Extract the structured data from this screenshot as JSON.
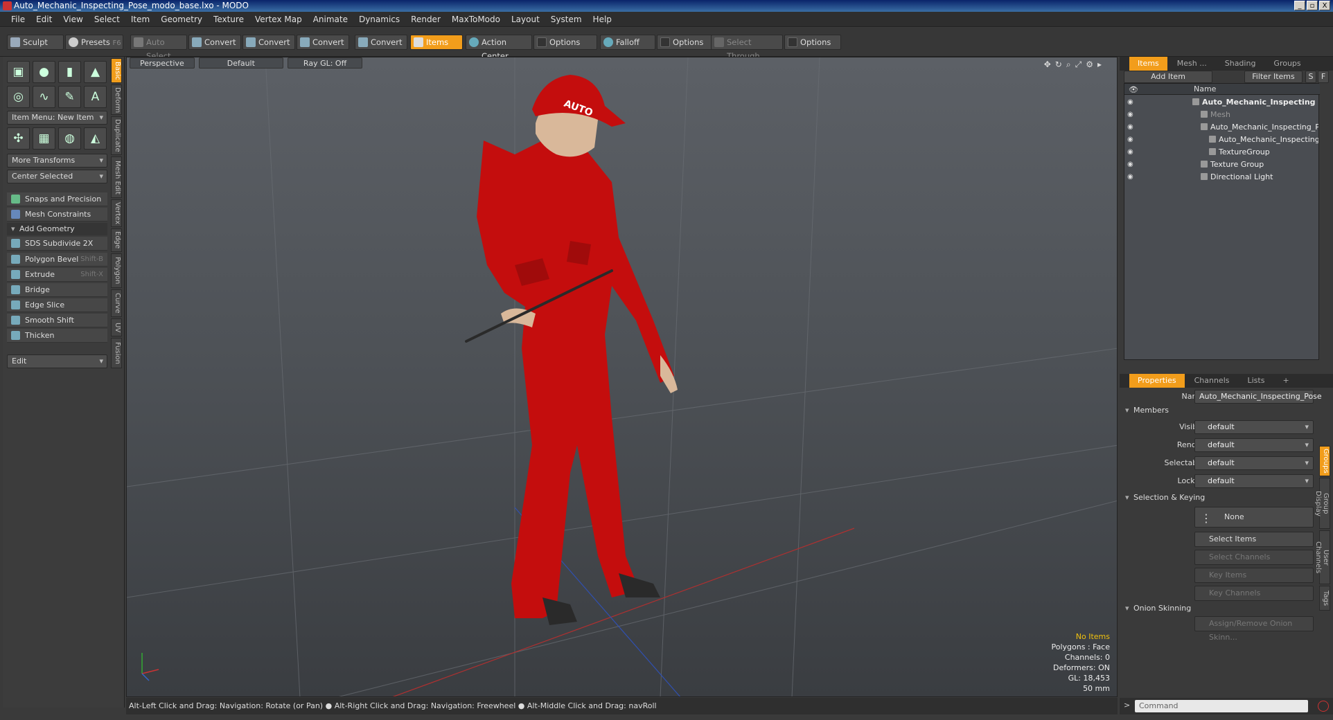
{
  "window": {
    "title": "Auto_Mechanic_Inspecting_Pose_modo_base.lxo - MODO",
    "buttons": [
      "_",
      "▫",
      "X"
    ]
  },
  "menu": [
    "File",
    "Edit",
    "View",
    "Select",
    "Item",
    "Geometry",
    "Texture",
    "Vertex Map",
    "Animate",
    "Dynamics",
    "Render",
    "MaxToModo",
    "Layout",
    "System",
    "Help"
  ],
  "toolbar": {
    "sculpt": "Sculpt",
    "presets": "Presets",
    "presets_key": "F6",
    "auto_select": "Auto Select",
    "convert1": "Convert",
    "convert2": "Convert",
    "convert3": "Convert",
    "convert4": "Convert",
    "items": "Items",
    "action_center": "Action Center",
    "options1": "Options",
    "falloff": "Falloff",
    "options2": "Options",
    "select_through": "Select Through",
    "options3": "Options"
  },
  "left": {
    "item_menu": "Item Menu: New Item",
    "more_transforms": "More Transforms",
    "center_selected": "Center Selected",
    "snaps": "Snaps and Precision",
    "mesh_constraints": "Mesh Constraints",
    "add_geometry": "Add Geometry",
    "tools": [
      {
        "label": "SDS Subdivide 2X",
        "key": ""
      },
      {
        "label": "Polygon Bevel",
        "key": "Shift-B"
      },
      {
        "label": "Extrude",
        "key": "Shift-X"
      },
      {
        "label": "Bridge",
        "key": ""
      },
      {
        "label": "Edge Slice",
        "key": ""
      },
      {
        "label": "Smooth Shift",
        "key": ""
      },
      {
        "label": "Thicken",
        "key": ""
      }
    ],
    "edit": "Edit",
    "vtabs": [
      "Basic",
      "Deform",
      "Duplicate",
      "Mesh Edit",
      "Vertex",
      "Edge",
      "Polygon",
      "Curve",
      "UV",
      "Fusion"
    ]
  },
  "viewport": {
    "view": "Perspective",
    "shading": "Default",
    "raygl": "Ray GL: Off",
    "info": {
      "no_items": "No Items",
      "polygons": "Polygons : Face",
      "channels": "Channels: 0",
      "deformers": "Deformers: ON",
      "gl": "GL: 18,453",
      "focal": "50 mm"
    },
    "cap_text": "AUTO"
  },
  "status": "Alt-Left Click and Drag: Navigation: Rotate (or Pan) ● Alt-Right Click and Drag: Navigation: Freewheel ● Alt-Middle Click and Drag: navRoll",
  "items_panel": {
    "tabs": [
      "Items",
      "Mesh ...",
      "Shading",
      "Groups"
    ],
    "add_item": "Add Item",
    "filter": "Filter Items",
    "s": "S",
    "f": "F",
    "col_name": "Name",
    "rows": [
      {
        "label": "Auto_Mechanic_Inspecting ..."
      },
      {
        "label": "Mesh"
      },
      {
        "label": "Auto_Mechanic_Inspecting_P ..."
      },
      {
        "label": "Auto_Mechanic_Inspecting ..."
      },
      {
        "label": "TextureGroup"
      },
      {
        "label": "Texture Group"
      },
      {
        "label": "Directional Light"
      }
    ]
  },
  "properties": {
    "tabs": [
      "Properties",
      "Channels",
      "Lists",
      "+"
    ],
    "name_label": "Name",
    "name_value": "Auto_Mechanic_Inspecting_Pose",
    "members": "Members",
    "visible_label": "Visible",
    "visible": "default",
    "render_label": "Render",
    "render": "default",
    "selectable_label": "Selectable",
    "selectable": "default",
    "locked_label": "Locked",
    "locked": "default",
    "sel_keying": "Selection & Keying",
    "none": "None",
    "select_items": "Select Items",
    "select_channels": "Select Channels",
    "key_items": "Key Items",
    "key_channels": "Key Channels",
    "onion": "Onion Skinning",
    "assign_onion": "Assign/Remove Onion Skinn...",
    "vtabs": [
      "Groups",
      "Group Display",
      "User Channels",
      "Tags"
    ]
  },
  "command": {
    "placeholder": "Command"
  }
}
